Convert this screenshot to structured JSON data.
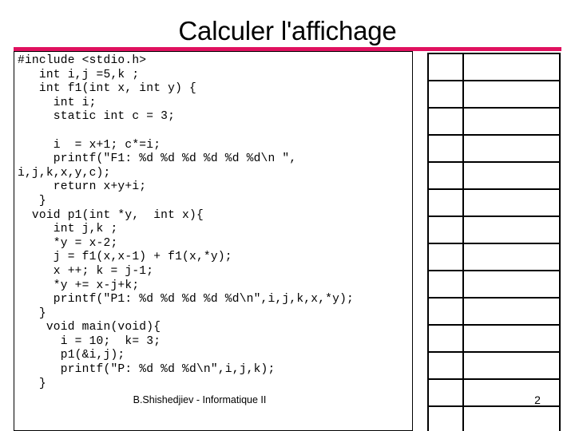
{
  "slide": {
    "title": "Calculer l'affichage",
    "accent_color": "#E0115F",
    "background_color": "#FFFFFF",
    "text_color": "#000000"
  },
  "code": {
    "language": "c",
    "listing": "#include <stdio.h>\n   int i,j =5,k ;\n   int f1(int x, int y) {\n     int i;\n     static int c = 3;\n\n     i  = x+1; c*=i;\n     printf(\"F1: %d %d %d %d %d %d\\n \",\ni,j,k,x,y,c);\n     return x+y+i;\n   }\n  void p1(int *y,  int x){\n     int j,k ;\n     *y = x-2;\n     j = f1(x,x-1) + f1(x,*y);\n     x ++; k = j-1;\n     *y += x-j+k;\n     printf(\"P1: %d %d %d %d %d\\n\",i,j,k,x,*y);\n   }\n    void main(void){\n      i = 10;  k= 3;\n      p1(&i,j);\n      printf(\"P: %d %d %d\\n\",i,j,k);\n   }"
  },
  "trace_table": {
    "column_count": 2,
    "row_count": 14,
    "columns": [
      "",
      ""
    ],
    "rows": [
      [
        "",
        ""
      ],
      [
        "",
        ""
      ],
      [
        "",
        ""
      ],
      [
        "",
        ""
      ],
      [
        "",
        ""
      ],
      [
        "",
        ""
      ],
      [
        "",
        ""
      ],
      [
        "",
        ""
      ],
      [
        "",
        ""
      ],
      [
        "",
        ""
      ],
      [
        "",
        ""
      ],
      [
        "",
        ""
      ],
      [
        "",
        ""
      ],
      [
        "",
        ""
      ]
    ]
  },
  "footer": {
    "author_line": "B.Shishedjiev - Informatique II",
    "page_number": "2"
  }
}
